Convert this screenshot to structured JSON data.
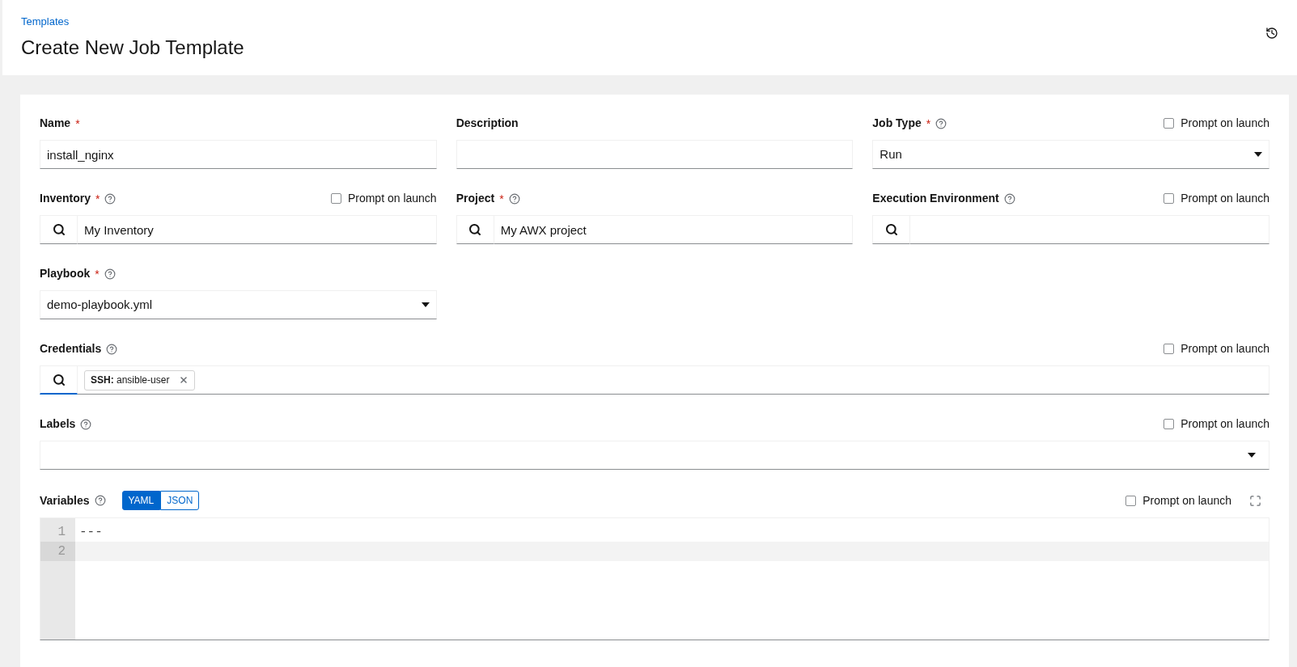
{
  "header": {
    "breadcrumb": "Templates",
    "title": "Create New Job Template"
  },
  "rows": [
    [
      {
        "kind": "text",
        "label": "Name",
        "required_mark": "*",
        "help": false,
        "value": "install_nginx"
      },
      {
        "kind": "text",
        "label": "Description",
        "help": false
      },
      {
        "kind": "select",
        "label": "Job Type",
        "required_mark": "*",
        "help": true,
        "value": "Run",
        "prompt": {
          "label": "Prompt on launch",
          "checked": false
        }
      }
    ],
    [
      {
        "kind": "lookup",
        "label": "Inventory",
        "required_mark": "*",
        "help": true,
        "value": "My Inventory",
        "prompt": {
          "label": "Prompt on launch",
          "checked": false
        }
      },
      {
        "kind": "lookup",
        "label": "Project",
        "required_mark": "*",
        "help": true,
        "value": "My AWX project"
      },
      {
        "kind": "lookup",
        "label": "Execution Environment",
        "help": true,
        "prompt": {
          "label": "Prompt on launch",
          "checked": false
        }
      }
    ],
    [
      {
        "kind": "select",
        "label": "Playbook",
        "required_mark": "*",
        "help": true,
        "value": "demo-playbook.yml"
      }
    ]
  ],
  "full_rows": [
    {
      "kind": "chips",
      "label": "Credentials",
      "help": true,
      "focused": true,
      "chips": [
        "**SSH:** ansible-user"
      ],
      "prompt": {
        "label": "Prompt on launch",
        "checked": false
      }
    },
    {
      "kind": "multiselect",
      "label": "Labels",
      "help": true,
      "prompt": {
        "label": "Prompt on launch",
        "checked": false
      }
    }
  ],
  "variables": {
    "label": "Variables",
    "help": true,
    "formats": [
      {
        "label": "YAML",
        "selected": true
      },
      {
        "label": "JSON",
        "selected": false
      }
    ],
    "prompt": {
      "label": "Prompt on launch",
      "checked": false
    },
    "lines": [
      {
        "number": "1",
        "text": "---",
        "current": false
      },
      {
        "number": "2",
        "current": true
      }
    ]
  }
}
